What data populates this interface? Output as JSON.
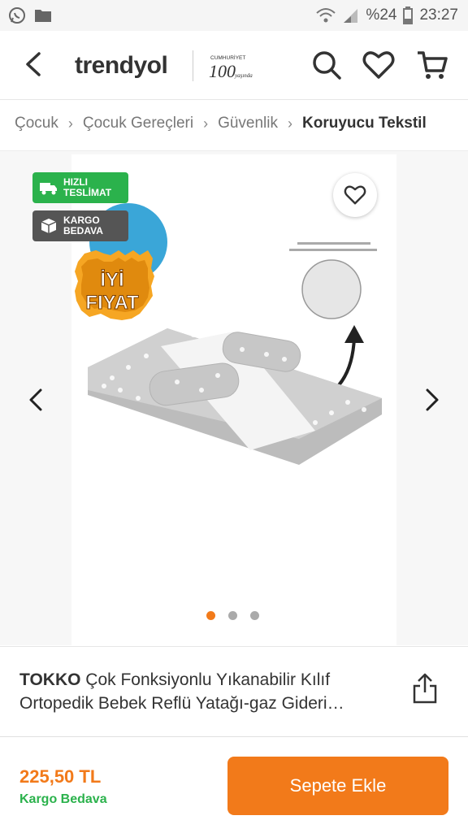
{
  "status_bar": {
    "battery": "%24",
    "time": "23:27",
    "icons": [
      "whatsapp-icon",
      "folder-icon",
      "wifi-icon",
      "signal-icon",
      "battery-icon"
    ]
  },
  "header": {
    "logo": "trendyol",
    "anniversary": {
      "top": "CUMHURİYET",
      "number": "100",
      "script": "yaşında"
    },
    "icons": [
      "back-icon",
      "search-icon",
      "heart-icon",
      "cart-icon"
    ]
  },
  "breadcrumb": {
    "items": [
      "Çocuk",
      "Çocuk Gereçleri",
      "Güvenlik"
    ],
    "current": "Koruyucu Tekstil"
  },
  "gallery": {
    "badges": [
      {
        "line1": "HIZLI",
        "line2": "TESLİMAT",
        "icon": "truck-icon"
      },
      {
        "line1": "KARGO",
        "line2": "BEDAVA",
        "icon": "box-icon"
      }
    ],
    "promo_sticker": {
      "line1": "İYİ",
      "line2": "FIYAT"
    },
    "slide_count": 3,
    "active_slide": 0,
    "colors": {
      "orange": "#f27a1a",
      "green": "#2bb24c",
      "badge_dark": "#555555"
    }
  },
  "product": {
    "brand": "TOKKO",
    "name": "Çok Fonksiyonlu Yıkanabilir Kılıf Ortopedik Bebek Reflü Yatağı-gaz Gideri…"
  },
  "bottom_bar": {
    "price": "225,50 TL",
    "shipping": "Kargo Bedava",
    "add_to_cart": "Sepete Ekle"
  }
}
